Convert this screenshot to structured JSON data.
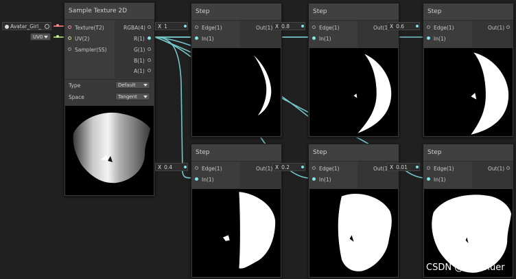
{
  "sample_node": {
    "title": "Sample Texture 2D",
    "inputs": [
      "Texture(T2)",
      "UV(2)",
      "Sampler(SS)"
    ],
    "outputs": [
      "RGBA(4)",
      "R(1)",
      "G(1)",
      "B(1)",
      "A(1)"
    ],
    "type_label": "Type",
    "type_value": "Default",
    "space_label": "Space",
    "space_value": "Tangent"
  },
  "texture_chip": "Avatar_Girl_",
  "uv_dropdown": "UV0",
  "step_nodes": [
    {
      "title": "Step",
      "edge_value": "1",
      "edge_label": "Edge(1)",
      "in_label": "In(1)",
      "out_label": "Out(1)"
    },
    {
      "title": "Step",
      "edge_value": "0.8",
      "edge_label": "Edge(1)",
      "in_label": "In(1)",
      "out_label": "Out(1)"
    },
    {
      "title": "Step",
      "edge_value": "0.6",
      "edge_label": "Edge(1)",
      "in_label": "In(1)",
      "out_label": "Out(1)"
    },
    {
      "title": "Step",
      "edge_value": "0.4",
      "edge_label": "Edge(1)",
      "in_label": "In(1)",
      "out_label": "Out(1)"
    },
    {
      "title": "Step",
      "edge_value": "0.2",
      "edge_label": "Edge(1)",
      "in_label": "In(1)",
      "out_label": "Out(1)"
    },
    {
      "title": "Step",
      "edge_value": "0.01",
      "edge_label": "Edge(1)",
      "in_label": "In(1)",
      "out_label": "Out(1)"
    }
  ],
  "chip_axis_label": "X",
  "watermark": "CSDN @coldbluer",
  "colors": {
    "wire": "#84e4e7",
    "texture_port": "#ff8b8b",
    "uv_port": "#c5f08a",
    "background": "#202020"
  }
}
